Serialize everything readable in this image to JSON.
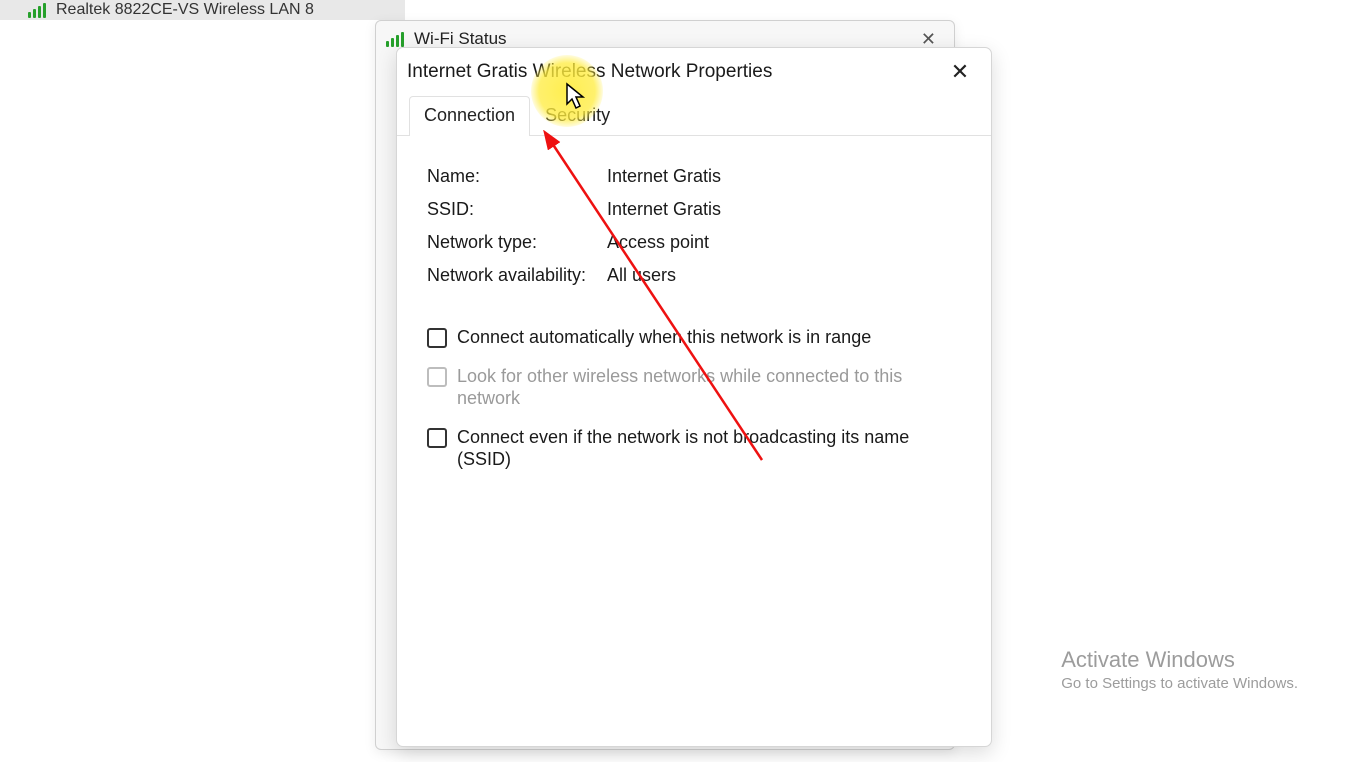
{
  "net_list_item": {
    "adapter_text": "Realtek 8822CE-VS Wireless LAN 8"
  },
  "bg_window": {
    "title": "Wi-Fi Status"
  },
  "dialog": {
    "title": "Internet Gratis Wireless Network Properties",
    "tabs": {
      "connection": "Connection",
      "security": "Security"
    },
    "info": {
      "name_label": "Name:",
      "name_value": "Internet Gratis",
      "ssid_label": "SSID:",
      "ssid_value": "Internet Gratis",
      "type_label": "Network type:",
      "type_value": "Access point",
      "avail_label": "Network availability:",
      "avail_value": "All users"
    },
    "checks": {
      "auto_label": "Connect automatically when this network is in range",
      "look_label": "Look for other wireless networks while connected to this network",
      "broadcast_label": "Connect even if the network is not broadcasting its name (SSID)"
    }
  },
  "watermark": {
    "title": "Activate Windows",
    "sub": "Go to Settings to activate Windows."
  }
}
